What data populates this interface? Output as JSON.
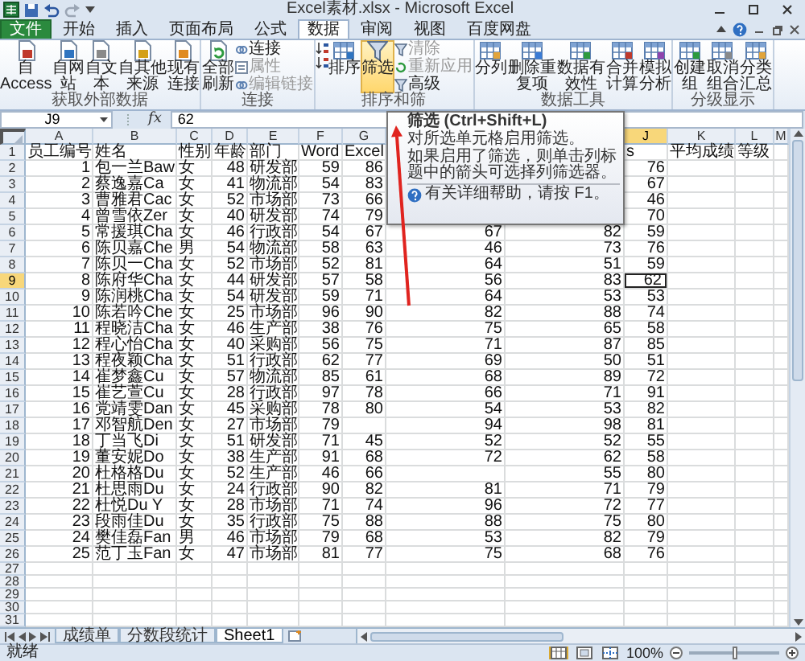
{
  "window": {
    "title": "Excel素材.xlsx - Microsoft Excel"
  },
  "tabs": [
    {
      "label": "文件",
      "kind": "file",
      "selected": false
    },
    {
      "label": "开始",
      "kind": "tab",
      "selected": false
    },
    {
      "label": "插入",
      "kind": "tab",
      "selected": false
    },
    {
      "label": "页面布局",
      "kind": "tab",
      "selected": false
    },
    {
      "label": "公式",
      "kind": "tab",
      "selected": false
    },
    {
      "label": "数据",
      "kind": "tab",
      "selected": true
    },
    {
      "label": "审阅",
      "kind": "tab",
      "selected": false
    },
    {
      "label": "视图",
      "kind": "tab",
      "selected": false
    },
    {
      "label": "百度网盘",
      "kind": "tab",
      "selected": false
    }
  ],
  "ribbon": {
    "groups": [
      {
        "label": "获取外部数据",
        "buttons": [
          {
            "label": "自 Access",
            "kind": "large",
            "disabled": false,
            "highlighted": false
          },
          {
            "label": "自网站",
            "kind": "large",
            "disabled": false,
            "highlighted": false
          },
          {
            "label": "自文本",
            "kind": "large",
            "disabled": false,
            "highlighted": false
          },
          {
            "label": "自其他来源",
            "kind": "large",
            "disabled": false,
            "highlighted": false
          },
          {
            "label": "现有连接",
            "kind": "large",
            "disabled": false,
            "highlighted": false
          }
        ]
      },
      {
        "label": "连接",
        "buttons": [
          {
            "label": "全部刷新",
            "kind": "large",
            "disabled": false,
            "highlighted": false
          },
          {
            "label": "连接",
            "kind": "small",
            "disabled": false,
            "highlighted": false
          },
          {
            "label": "属性",
            "kind": "small",
            "disabled": true,
            "highlighted": false
          },
          {
            "label": "编辑链接",
            "kind": "small",
            "disabled": true,
            "highlighted": false
          }
        ]
      },
      {
        "label": "排序和筛",
        "buttons": [
          {
            "kind": "sort-icons",
            "disabled": false,
            "highlighted": false
          },
          {
            "label": "排序",
            "kind": "large",
            "disabled": false,
            "highlighted": false
          },
          {
            "label": "筛选",
            "kind": "large",
            "disabled": false,
            "highlighted": true
          },
          {
            "label": "清除",
            "kind": "small",
            "disabled": true,
            "highlighted": false
          },
          {
            "label": "重新应用",
            "kind": "small",
            "disabled": true,
            "highlighted": false
          },
          {
            "label": "高级",
            "kind": "small",
            "disabled": false,
            "highlighted": false
          }
        ]
      },
      {
        "label": "数据工具",
        "buttons": [
          {
            "label": "分列",
            "kind": "large",
            "disabled": false,
            "highlighted": false
          },
          {
            "label": "删除重复项",
            "kind": "large",
            "disabled": false,
            "highlighted": false
          },
          {
            "label": "数据有效性",
            "kind": "large",
            "disabled": false,
            "highlighted": false
          },
          {
            "label": "合并计算",
            "kind": "large",
            "disabled": false,
            "highlighted": false
          },
          {
            "label": "模拟分析",
            "kind": "large",
            "disabled": false,
            "highlighted": false
          }
        ]
      },
      {
        "label": "分级显示",
        "buttons": [
          {
            "label": "创建组",
            "kind": "large",
            "disabled": false,
            "highlighted": false
          },
          {
            "label": "取消组合",
            "kind": "large",
            "disabled": false,
            "highlighted": false
          },
          {
            "label": "分类汇总",
            "kind": "large",
            "disabled": false,
            "highlighted": false
          }
        ]
      }
    ]
  },
  "formula_bar": {
    "name_box": "J9",
    "fx": "fx",
    "value": "62"
  },
  "sheet": {
    "columns": [
      {
        "label": "A",
        "selected": false
      },
      {
        "label": "B",
        "selected": false
      },
      {
        "label": "C",
        "selected": false
      },
      {
        "label": "D",
        "selected": false
      },
      {
        "label": "E",
        "selected": false
      },
      {
        "label": "F",
        "selected": false
      },
      {
        "label": "G",
        "selected": false
      },
      {},
      {},
      {
        "label": "J",
        "selected": true
      },
      {
        "label": "K",
        "selected": false
      },
      {
        "label": "L",
        "selected": false
      },
      {
        "label": "M",
        "selected": false
      }
    ],
    "rows": [
      {
        "number": "1",
        "selected": false,
        "cells": {
          "A": "员工编号",
          "B": "姓名",
          "C": "性别",
          "D": "年龄",
          "E": "部门",
          "F": "Word",
          "G": "Excel",
          "J": "s",
          "K": "平均成绩",
          "L": "等级"
        }
      },
      {
        "number": "2",
        "selected": false,
        "cells": {
          "A": "1",
          "B": "包一兰Baw",
          "C": "女",
          "D": "48",
          "E": "研发部",
          "F": "59",
          "G": "86",
          "J": "76"
        }
      },
      {
        "number": "3",
        "selected": false,
        "cells": {
          "A": "2",
          "B": "蔡逸嘉Ca",
          "C": "女",
          "D": "41",
          "E": "物流部",
          "F": "54",
          "G": "83",
          "J": "67"
        }
      },
      {
        "number": "4",
        "selected": false,
        "cells": {
          "A": "3",
          "B": "曹雅君Cac",
          "C": "女",
          "D": "52",
          "E": "市场部",
          "F": "73",
          "G": "66",
          "J": "46"
        }
      },
      {
        "number": "5",
        "selected": false,
        "cells": {
          "A": "4",
          "B": "曾雪依Zer",
          "C": "女",
          "D": "40",
          "E": "研发部",
          "F": "74",
          "G": "79",
          "J": "70"
        }
      },
      {
        "number": "6",
        "selected": false,
        "cells": {
          "A": "5",
          "B": "常援琪Cha",
          "C": "女",
          "D": "46",
          "E": "行政部",
          "F": "54",
          "G": "67",
          "H": "67",
          "I": "82",
          "J": "59"
        }
      },
      {
        "number": "7",
        "selected": false,
        "cells": {
          "A": "6",
          "B": "陈贝嘉Che",
          "C": "男",
          "D": "54",
          "E": "物流部",
          "F": "58",
          "G": "63",
          "H": "46",
          "I": "73",
          "J": "76"
        }
      },
      {
        "number": "8",
        "selected": false,
        "cells": {
          "A": "7",
          "B": "陈贝一Cha",
          "C": "女",
          "D": "52",
          "E": "市场部",
          "F": "52",
          "G": "81",
          "H": "64",
          "I": "51",
          "J": "59"
        }
      },
      {
        "number": "9",
        "selected": true,
        "cells": {
          "A": "8",
          "B": "陈府华Cha",
          "C": "女",
          "D": "44",
          "E": "研发部",
          "F": "57",
          "G": "58",
          "H": "56",
          "I": "83",
          "J": "62"
        }
      },
      {
        "number": "10",
        "selected": false,
        "cells": {
          "A": "9",
          "B": "陈润桃Cha",
          "C": "女",
          "D": "54",
          "E": "研发部",
          "F": "59",
          "G": "71",
          "H": "64",
          "I": "53",
          "J": "53"
        }
      },
      {
        "number": "11",
        "selected": false,
        "cells": {
          "A": "10",
          "B": "陈若吟Che",
          "C": "女",
          "D": "25",
          "E": "市场部",
          "F": "96",
          "G": "90",
          "H": "82",
          "I": "88",
          "J": "74"
        }
      },
      {
        "number": "12",
        "selected": false,
        "cells": {
          "A": "11",
          "B": "程晓洁Cha",
          "C": "女",
          "D": "46",
          "E": "生产部",
          "F": "38",
          "G": "76",
          "H": "75",
          "I": "65",
          "J": "58"
        }
      },
      {
        "number": "13",
        "selected": false,
        "cells": {
          "A": "12",
          "B": "程心怡Cha",
          "C": "女",
          "D": "40",
          "E": "采购部",
          "F": "56",
          "G": "75",
          "H": "71",
          "I": "87",
          "J": "85"
        }
      },
      {
        "number": "14",
        "selected": false,
        "cells": {
          "A": "13",
          "B": "程夜颖Cha",
          "C": "女",
          "D": "51",
          "E": "行政部",
          "F": "62",
          "G": "77",
          "H": "69",
          "I": "50",
          "J": "51"
        }
      },
      {
        "number": "15",
        "selected": false,
        "cells": {
          "A": "14",
          "B": "崔梦鑫Cu",
          "C": "女",
          "D": "57",
          "E": "物流部",
          "F": "85",
          "G": "61",
          "H": "68",
          "I": "89",
          "J": "72"
        }
      },
      {
        "number": "16",
        "selected": false,
        "cells": {
          "A": "15",
          "B": "崔艺萱Cu",
          "C": "女",
          "D": "28",
          "E": "行政部",
          "F": "97",
          "G": "78",
          "H": "66",
          "I": "71",
          "J": "91"
        }
      },
      {
        "number": "17",
        "selected": false,
        "cells": {
          "A": "16",
          "B": "党靖雯Dan",
          "C": "女",
          "D": "45",
          "E": "采购部",
          "F": "78",
          "G": "80",
          "H": "54",
          "I": "53",
          "J": "82"
        }
      },
      {
        "number": "18",
        "selected": false,
        "cells": {
          "A": "17",
          "B": "邓智航Den",
          "C": "女",
          "D": "27",
          "E": "市场部",
          "F": "79",
          "H": "94",
          "I": "98",
          "J": "81"
        }
      },
      {
        "number": "19",
        "selected": false,
        "cells": {
          "A": "18",
          "B": "丁当飞Di",
          "C": "女",
          "D": "51",
          "E": "研发部",
          "F": "71",
          "G": "45",
          "H": "52",
          "I": "52",
          "J": "55"
        }
      },
      {
        "number": "20",
        "selected": false,
        "cells": {
          "A": "19",
          "B": "董安妮Do",
          "C": "女",
          "D": "38",
          "E": "生产部",
          "F": "91",
          "G": "68",
          "H": "72",
          "I": "62",
          "J": "58"
        }
      },
      {
        "number": "21",
        "selected": false,
        "cells": {
          "A": "20",
          "B": "杜格格Du",
          "C": "女",
          "D": "52",
          "E": "生产部",
          "F": "46",
          "G": "66",
          "I": "55",
          "J": "80"
        }
      },
      {
        "number": "22",
        "selected": false,
        "cells": {
          "A": "21",
          "B": "杜思雨Du",
          "C": "女",
          "D": "24",
          "E": "行政部",
          "F": "90",
          "G": "82",
          "H": "81",
          "I": "71",
          "J": "79"
        }
      },
      {
        "number": "23",
        "selected": false,
        "cells": {
          "A": "22",
          "B": "杜悦Du Y",
          "C": "女",
          "D": "28",
          "E": "市场部",
          "F": "71",
          "G": "74",
          "H": "96",
          "I": "72",
          "J": "77"
        }
      },
      {
        "number": "24",
        "selected": false,
        "cells": {
          "A": "23",
          "B": "段雨佳Du",
          "C": "女",
          "D": "35",
          "E": "行政部",
          "F": "75",
          "G": "88",
          "H": "88",
          "I": "75",
          "J": "80"
        }
      },
      {
        "number": "25",
        "selected": false,
        "cells": {
          "A": "24",
          "B": "樊佳磊Fan",
          "C": "男",
          "D": "46",
          "E": "市场部",
          "F": "79",
          "G": "68",
          "H": "53",
          "I": "82",
          "J": "79"
        }
      },
      {
        "number": "26",
        "selected": false,
        "cells": {
          "A": "25",
          "B": "范丁玉Fan",
          "C": "女",
          "D": "47",
          "E": "市场部",
          "F": "81",
          "G": "77",
          "H": "75",
          "I": "68",
          "J": "76"
        }
      },
      {
        "number": "27",
        "selected": false
      },
      {
        "number": "28",
        "selected": false
      },
      {
        "number": "29",
        "selected": false
      },
      {
        "number": "30",
        "selected": false
      },
      {
        "number": "31",
        "selected": false
      }
    ]
  },
  "tooltip": {
    "title": "筛选 (Ctrl+Shift+L)",
    "text": "对所选单元格启用筛选。",
    "detail": "如果启用了筛选，则单击列标题中的箭头可选择列筛选器。",
    "help": "有关详细帮助，请按 F1。"
  },
  "sheet_tabs": [
    {
      "label": "成绩单",
      "selected": false
    },
    {
      "label": "分数段统计",
      "selected": false
    },
    {
      "label": "Sheet1",
      "selected": true
    }
  ],
  "status_bar": {
    "status": "就绪",
    "views": [
      {
        "selected": true
      },
      {
        "selected": false
      },
      {
        "selected": false
      }
    ],
    "zoom": "100%",
    "zoom_slider": {
      "level": 0.5
    }
  }
}
